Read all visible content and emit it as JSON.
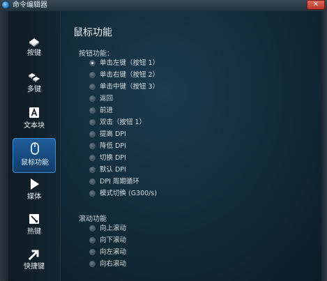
{
  "window": {
    "title": "命令编辑器",
    "close_label": "✕"
  },
  "sidebar": {
    "items": [
      {
        "label": "按键",
        "icon": "key-icon",
        "active": false
      },
      {
        "label": "多键",
        "icon": "multi-key-icon",
        "active": false
      },
      {
        "label": "文本块",
        "icon": "text-block-icon",
        "active": false
      },
      {
        "label": "鼠标功能",
        "icon": "mouse-icon",
        "active": true
      },
      {
        "label": "媒体",
        "icon": "play-icon",
        "active": false
      },
      {
        "label": "热键",
        "icon": "hotkey-icon",
        "active": false
      },
      {
        "label": "快捷键",
        "icon": "shortcut-arrow-icon",
        "active": false
      }
    ]
  },
  "main": {
    "title": "鼠标功能",
    "button_section": {
      "title": "按钮功能：",
      "options": [
        {
          "label": "单击左键（按钮 1）",
          "selected": true
        },
        {
          "label": "单击右键（按钮 2）",
          "selected": false
        },
        {
          "label": "单击中键（按钮 3）",
          "selected": false
        },
        {
          "label": "返回",
          "selected": false
        },
        {
          "label": "前进",
          "selected": false
        },
        {
          "label": "双击（按钮 1）",
          "selected": false
        },
        {
          "label": "提高 DPI",
          "selected": false
        },
        {
          "label": "降低 DPI",
          "selected": false
        },
        {
          "label": "切换 DPI",
          "selected": false
        },
        {
          "label": "默认 DPI",
          "selected": false
        },
        {
          "label": "DPI 周期循环",
          "selected": false
        },
        {
          "label": "模式切换 (G300/s)",
          "selected": false
        }
      ]
    },
    "scroll_section": {
      "title": "滚动功能",
      "options": [
        {
          "label": "向上滚动",
          "selected": false
        },
        {
          "label": "向下滚动",
          "selected": false
        },
        {
          "label": "向左滚动",
          "selected": false
        },
        {
          "label": "向右滚动",
          "selected": false
        }
      ]
    }
  }
}
